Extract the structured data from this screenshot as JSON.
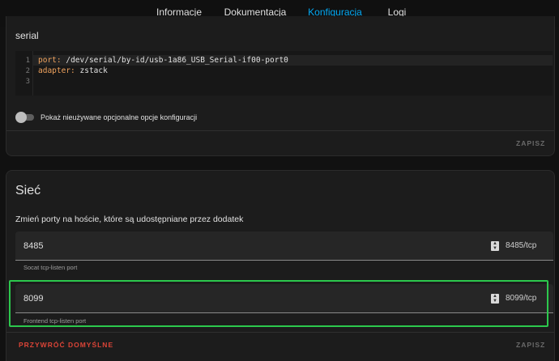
{
  "tabs": [
    {
      "label": "Informacje",
      "active": false
    },
    {
      "label": "Dokumentacja",
      "active": false
    },
    {
      "label": "Konfiguracja",
      "active": true
    },
    {
      "label": "Logi",
      "active": false
    }
  ],
  "config_card": {
    "section_label": "serial",
    "code_lines": [
      {
        "number": "1",
        "key": "port",
        "value": " /dev/serial/by-id/usb-1a86_USB_Serial-if00-port0"
      },
      {
        "number": "2",
        "key": "adapter",
        "value": " zstack"
      },
      {
        "number": "3",
        "key": "",
        "value": ""
      }
    ],
    "toggle_label": "Pokaż nieużywane opcjonalne opcje konfiguracji",
    "toggle_on": false,
    "save_label": "ZAPISZ"
  },
  "network_card": {
    "title": "Sieć",
    "description": "Zmień porty na hoście, które są udostępniane przez dodatek",
    "fields": [
      {
        "value": "8485",
        "suffix": "8485/tcp",
        "helper": "Socat tcp-listen port"
      },
      {
        "value": "8099",
        "suffix": "8099/tcp",
        "helper": "Frontend tcp-listen port"
      }
    ],
    "reset_label": "PRZYWRÓĆ DOMYŚLNE",
    "save_label": "ZAPISZ"
  },
  "colors": {
    "accent": "#03a9f4",
    "highlight": "#2cc84d",
    "danger": "#db4437"
  }
}
